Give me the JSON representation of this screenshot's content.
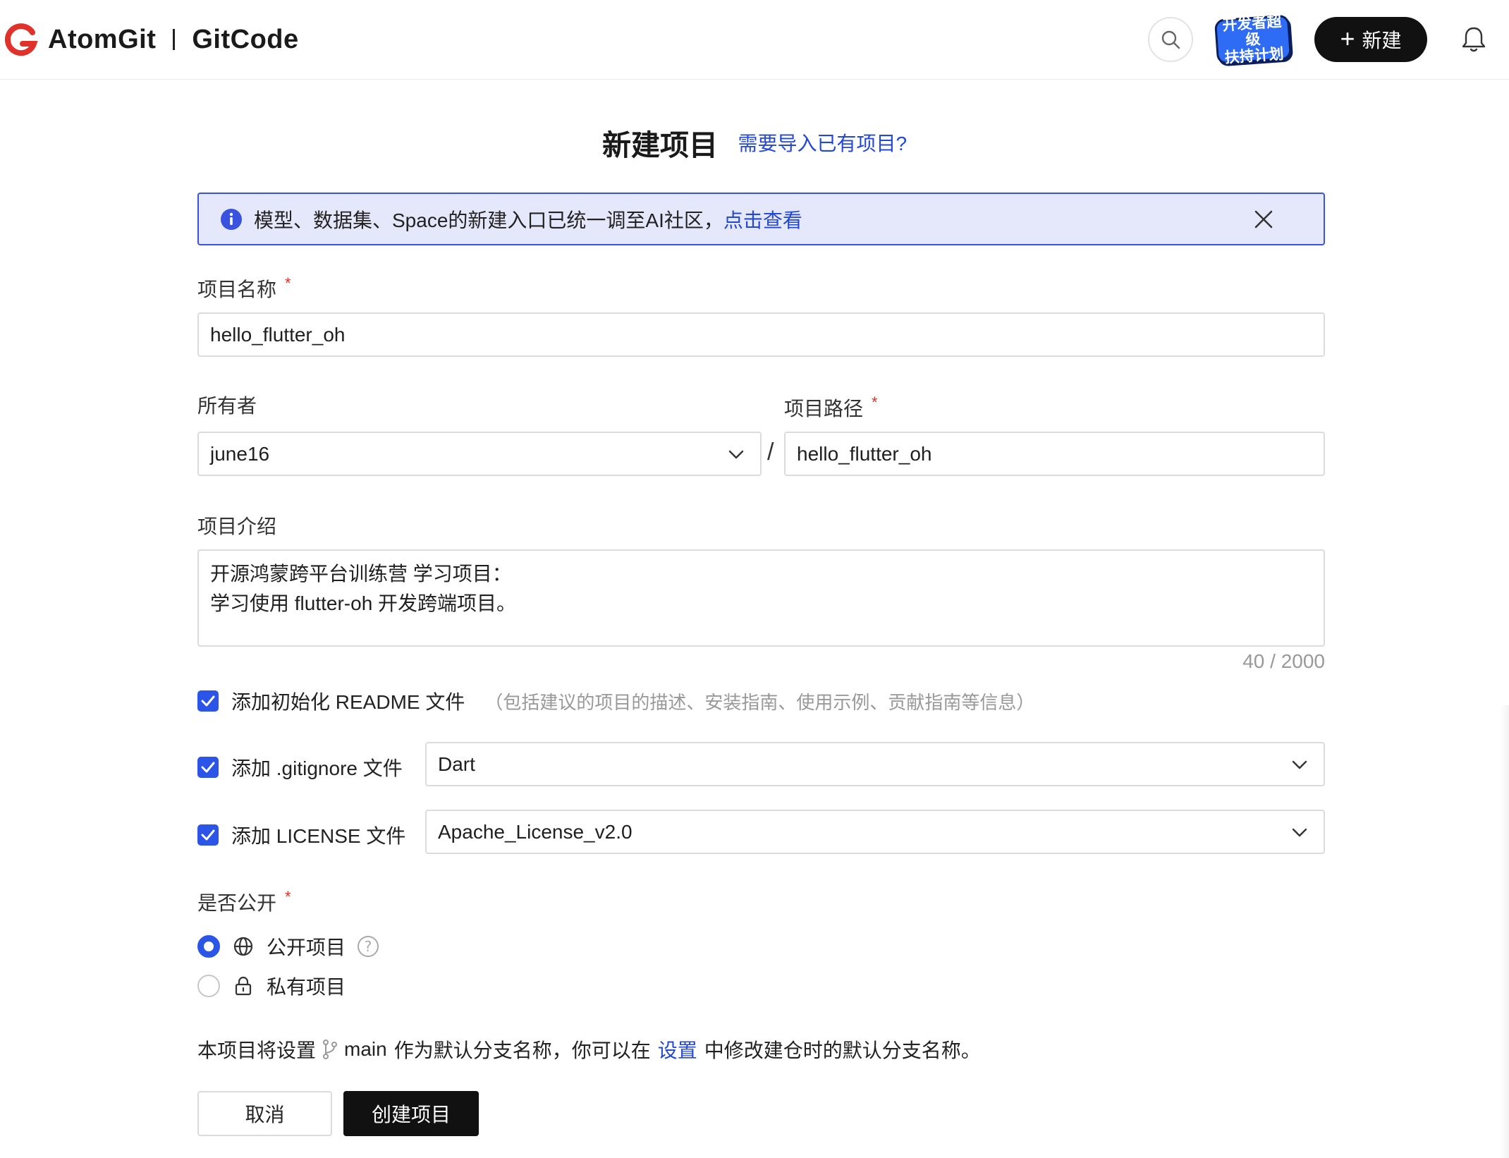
{
  "header": {
    "brand_primary": "AtomGit",
    "brand_secondary": "GitCode",
    "promo_line1": "开发者超级",
    "promo_line2": "扶持计划",
    "new_button": "新建",
    "accent_color": "#e0312b"
  },
  "page": {
    "title": "新建项目",
    "import_link": "需要导入已有项目?"
  },
  "notice": {
    "text": "模型、数据集、Space的新建入口已统一调至AI社区，",
    "link": "点击查看"
  },
  "form": {
    "name_label": "项目名称",
    "required_mark": "*",
    "name_value": "hello_flutter_oh",
    "owner_label": "所有者",
    "owner_value": "june16",
    "path_separator": "/",
    "path_label": "项目路径",
    "path_value": "hello_flutter_oh",
    "intro_label": "项目介绍",
    "intro_line1": "开源鸿蒙跨平台训练营 学习项目：",
    "intro_line2": "学习使用 flutter-oh 开发跨端项目。",
    "intro_counter": "40 / 2000",
    "readme_label": "添加初始化 README 文件",
    "readme_hint": "（包括建议的项目的描述、安装指南、使用示例、贡献指南等信息）",
    "readme_checked": true,
    "gitignore_label": "添加 .gitignore 文件",
    "gitignore_checked": true,
    "gitignore_value": "Dart",
    "license_label": "添加 LICENSE 文件",
    "license_checked": true,
    "license_value": "Apache_License_v2.0",
    "visibility_label": "是否公开",
    "visibility_public": "公开项目",
    "visibility_private": "私有项目",
    "visibility_selected": "public",
    "branch_note_prefix": "本项目将设置",
    "branch_name": "main",
    "branch_note_mid": "作为默认分支名称，你可以在",
    "branch_settings_link": "设置",
    "branch_note_suffix": "中修改建仓时的默认分支名称。",
    "cancel_button": "取消",
    "create_button": "创建项目"
  },
  "colors": {
    "primary_blue": "#2b55e6",
    "link_blue": "#2347d6",
    "notice_bg": "#e5e8fb",
    "dark_button": "#111111"
  }
}
